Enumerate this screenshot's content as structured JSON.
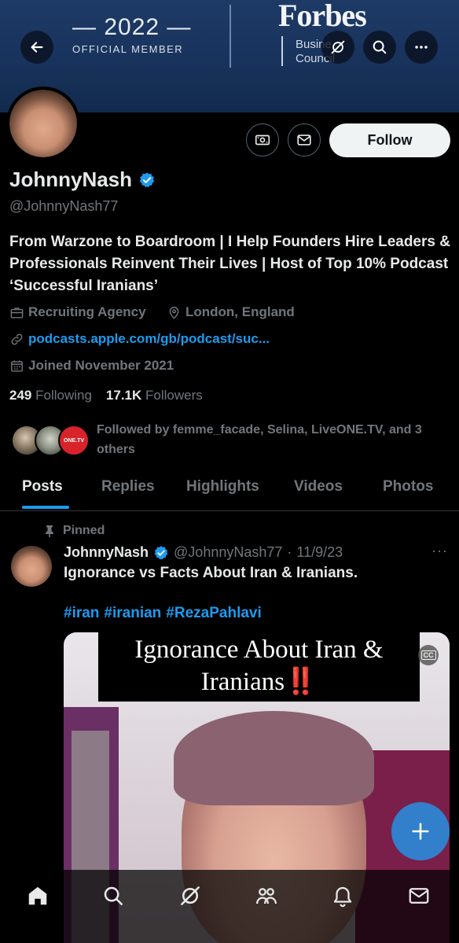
{
  "banner": {
    "year": "— 2022 —",
    "official": "OFFICIAL MEMBER",
    "forbes": "Forbes",
    "council_line1": "Busine",
    "council_line2": "Council"
  },
  "header_buttons": {
    "back": "back-arrow-icon",
    "grok": "grok-icon",
    "search": "search-icon",
    "more": "more-icon"
  },
  "profile": {
    "name": "JohnnyNash",
    "handle": "@JohnnyNash77",
    "bio": "From Warzone to Boardroom | I Help Founders Hire Leaders & Professionals Reinvent Their Lives | Host of Top 10% Podcast ‘Successful Iranians’",
    "category": "Recruiting Agency",
    "location": "London, England",
    "link": "podcasts.apple.com/gb/podcast/suc...",
    "joined": "Joined November 2021",
    "following_count": "249",
    "following_label": "Following",
    "followers_count": "17.1K",
    "followers_label": "Followers",
    "followed_by": "Followed by femme_facade, Selina, LiveONE.TV, and 3 others",
    "follow_button": "Follow",
    "verified_color": "#1d9bf0"
  },
  "followed_avatars": {
    "third_label": "ONE.TV"
  },
  "tabs": [
    {
      "label": "Posts",
      "active": true
    },
    {
      "label": "Replies",
      "active": false
    },
    {
      "label": "Highlights",
      "active": false
    },
    {
      "label": "Videos",
      "active": false
    },
    {
      "label": "Photos",
      "active": false
    }
  ],
  "post": {
    "pinned_label": "Pinned",
    "author_name": "JohnnyNash",
    "author_handle": "@JohnnyNash77",
    "separator": "·",
    "date": "11/9/23",
    "more": "···",
    "text": "Ignorance vs Facts About Iran & Iranians.",
    "hashtags": [
      "#iran",
      "#iranian",
      "#RezaPahlavi"
    ],
    "media_caption_line1": "Ignorance About Iran &",
    "media_caption_line2": "Iranians",
    "media_caption_bang": "‼️",
    "cc_label": "CC"
  },
  "colors": {
    "accent": "#1d9bf0",
    "text_primary": "#e7e9ea",
    "text_secondary": "#71767b",
    "background": "#000000"
  },
  "bottom_nav": [
    "home-icon",
    "search-icon",
    "grok-icon",
    "communities-icon",
    "notifications-icon",
    "messages-icon"
  ]
}
